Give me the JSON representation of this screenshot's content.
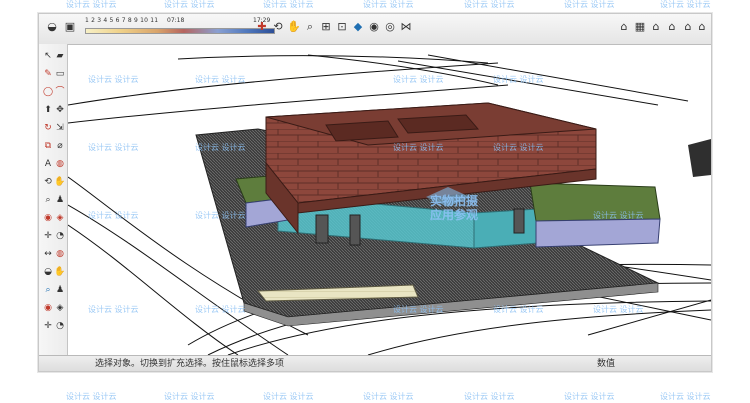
{
  "watermark": {
    "text": "设计云 设计云",
    "center_text_line1": "实物拍摄",
    "center_text_line2": "应用参观"
  },
  "toolbar": {
    "scale_ticks": "1 2 3 4 5 6 7 8 9 10 11 12",
    "scale_mid_value": "07:18",
    "scale_end_value": "17:29",
    "icons_left": [
      "orbit-icon",
      "select-icon"
    ],
    "icons_middle": [
      "paint-icon",
      "orbit-icon",
      "pan-icon",
      "zoom-icon",
      "zoom-window-icon",
      "zoom-extents-icon",
      "walk-icon",
      "look-around-icon",
      "position-camera-icon",
      "footprint-icon"
    ],
    "icons_right": [
      "iso-view-icon",
      "top-view-icon",
      "front-view-icon",
      "right-view-icon",
      "back-view-icon",
      "left-view-icon"
    ]
  },
  "left_tools": {
    "icons": [
      "select-icon",
      "eraser-icon",
      "pencil-icon",
      "rectangle-icon",
      "circle-icon",
      "arc-icon",
      "push-pull-icon",
      "move-icon",
      "rotate-icon",
      "scale-icon",
      "offset-icon",
      "tape-measure-icon",
      "text-icon",
      "paint-bucket-icon",
      "orbit-icon",
      "pan-icon",
      "zoom-icon",
      "walk-icon",
      "look-around-icon",
      "section-plane-icon",
      "axes-icon",
      "protractor-icon",
      "dimension-icon"
    ]
  },
  "statusbar": {
    "left_text": "选择对象。切换到扩充选择。按住鼠标选择多项",
    "right_text": "数值"
  },
  "colors": {
    "building_facade": "#8d473c",
    "building_roof": "#7a3d33",
    "green_roof": "#5e7d3d",
    "glass_blue": "#57c7cf",
    "base_dark": "#424242",
    "base_light": "#e9e5c3",
    "side_purple": "#a3a6d6"
  }
}
